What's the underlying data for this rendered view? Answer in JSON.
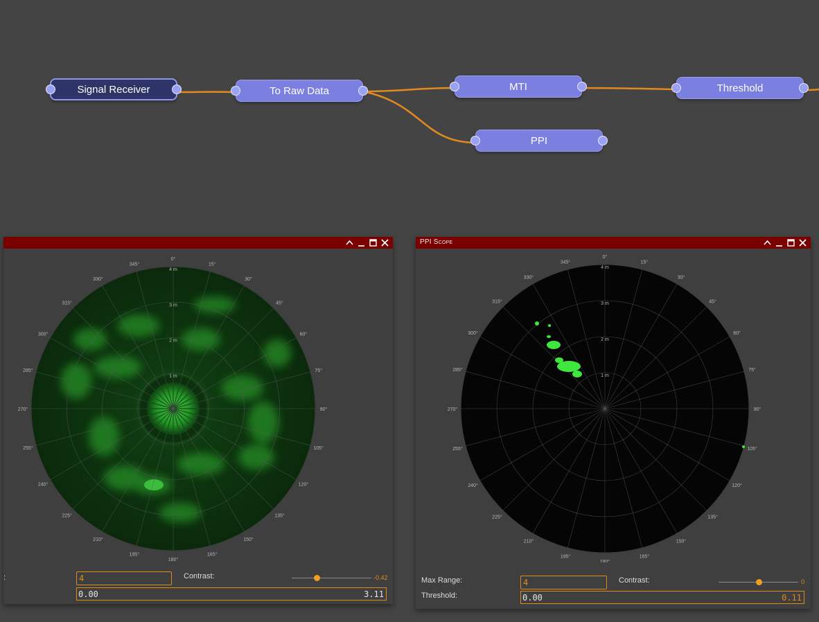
{
  "graph": {
    "nodes": [
      {
        "id": "signal-receiver",
        "label": "Signal Receiver"
      },
      {
        "id": "to-raw-data",
        "label": "To Raw Data"
      },
      {
        "id": "mti",
        "label": "MTI"
      },
      {
        "id": "threshold",
        "label": "Threshold"
      },
      {
        "id": "ppi",
        "label": "PPI"
      }
    ],
    "edge_color": "#e38a1e"
  },
  "polar_labels": {
    "angles": [
      "0°",
      "15°",
      "30°",
      "45°",
      "60°",
      "75°",
      "90°",
      "105°",
      "120°",
      "135°",
      "150°",
      "165°",
      "180°",
      "195°",
      "210°",
      "225°",
      "240°",
      "255°",
      "270°",
      "285°",
      "300°",
      "315°",
      "330°",
      "345°"
    ],
    "ranges": [
      "1 m",
      "2 m",
      "3 m",
      "4 m"
    ]
  },
  "left_window": {
    "title": "",
    "controls": {
      "max_range_label_fragment": ":",
      "max_range_value": "4",
      "contrast_label": "Contrast:",
      "contrast_value": "-0.42",
      "contrast_fraction": 0.31,
      "threshold_low": "0.00",
      "threshold_high": "3.11"
    }
  },
  "right_window": {
    "title": "PPI Scope",
    "controls": {
      "max_range_label": "Max Range:",
      "max_range_value": "4",
      "contrast_label": "Contrast:",
      "contrast_value": "0",
      "contrast_fraction": 0.5,
      "threshold_label": "Threshold:",
      "threshold_low": "0.00",
      "threshold_high": "0.11"
    }
  },
  "window_buttons": [
    "chevron-up-icon",
    "minimize-icon",
    "maximize-icon",
    "close-icon"
  ],
  "colors": {
    "titlebar": "#7a0000",
    "accent": "#e08a1a",
    "node": "#7a7fe0",
    "node_selected": "#2e3468",
    "radar_green": "#2bd42b"
  }
}
